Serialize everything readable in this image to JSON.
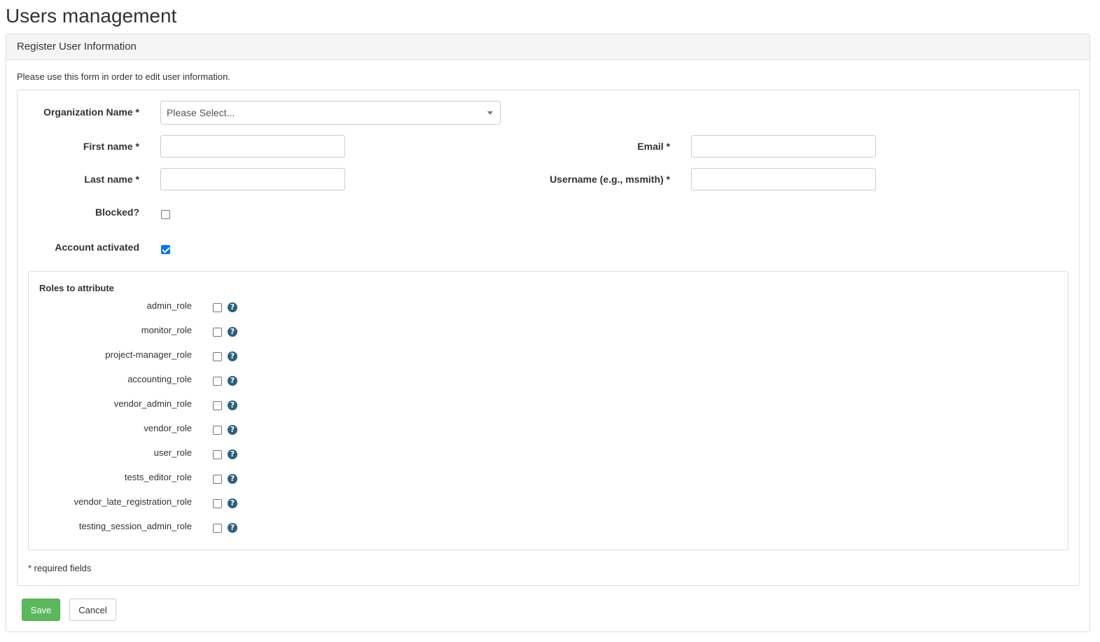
{
  "page": {
    "title": "Users management"
  },
  "panel": {
    "heading": "Register User Information",
    "intro": "Please use this form in order to edit user information."
  },
  "form": {
    "organization": {
      "label": "Organization Name *",
      "placeholder": "Please Select..."
    },
    "first_name": {
      "label": "First name *",
      "value": ""
    },
    "last_name": {
      "label": "Last name *",
      "value": ""
    },
    "email": {
      "label": "Email *",
      "value": ""
    },
    "username": {
      "label": "Username (e.g., msmith) *",
      "value": ""
    },
    "blocked": {
      "label": "Blocked?",
      "checked": false
    },
    "account_activated": {
      "label": "Account activated",
      "checked": true
    }
  },
  "roles": {
    "title": "Roles to attribute",
    "items": [
      {
        "label": "admin_role",
        "checked": false
      },
      {
        "label": "monitor_role",
        "checked": false
      },
      {
        "label": "project-manager_role",
        "checked": false
      },
      {
        "label": "accounting_role",
        "checked": false
      },
      {
        "label": "vendor_admin_role",
        "checked": false
      },
      {
        "label": "vendor_role",
        "checked": false
      },
      {
        "label": "user_role",
        "checked": false
      },
      {
        "label": "tests_editor_role",
        "checked": false
      },
      {
        "label": "vendor_late_registration_role",
        "checked": false
      },
      {
        "label": "testing_session_admin_role",
        "checked": false
      }
    ],
    "help_glyph": "?"
  },
  "footer": {
    "required_note": "* required fields"
  },
  "buttons": {
    "save": "Save",
    "cancel": "Cancel"
  },
  "colors": {
    "save_button": "#5cb85c",
    "help_icon": "#2b5f7e",
    "checkbox_checked": "#0075ff"
  }
}
